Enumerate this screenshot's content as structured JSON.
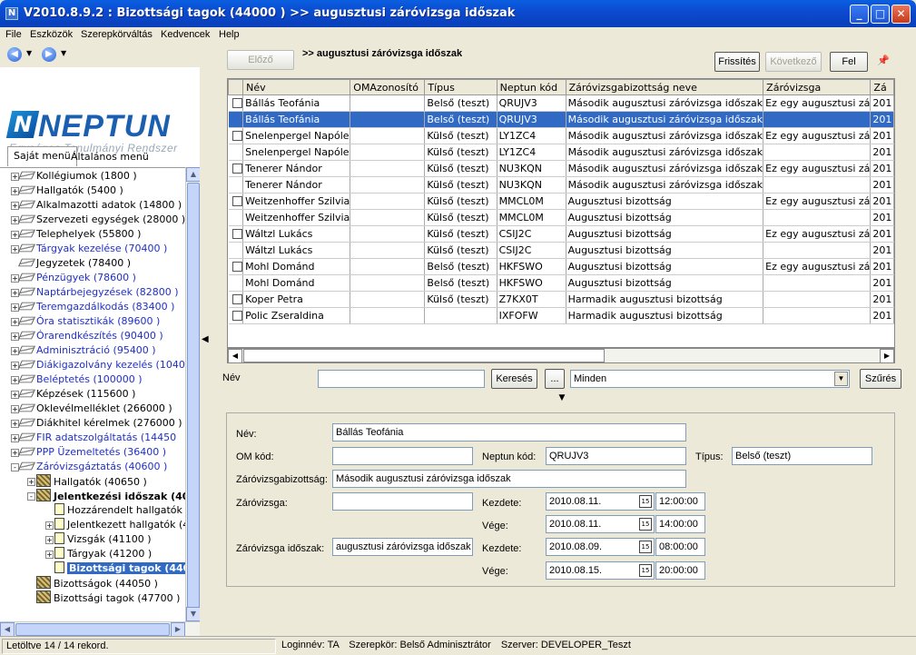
{
  "window": {
    "title": "V2010.8.9.2 : Bizottsági tagok (44000  )  >> augusztusi záróvizsga időszak",
    "icon_letter": "N",
    "min_glyph": "_",
    "max_glyph": "□",
    "close_glyph": "✕"
  },
  "menu": [
    "File",
    "Eszközök",
    "Szerepkörváltás",
    "Kedvencek",
    "Help"
  ],
  "logo": {
    "text": "NEPTUN",
    "mark": "N",
    "subtitle": "Egységes Tanulmányi Rendszer"
  },
  "left_tabs": {
    "own": "Saját menü",
    "general": "Általános menü"
  },
  "tree": [
    {
      "label": "Kollégiumok (1800  )",
      "color": "black",
      "level": 0,
      "icon": "pen",
      "exp": "+"
    },
    {
      "label": "Hallgatók (5400  )",
      "color": "black",
      "level": 0,
      "icon": "pen",
      "exp": "+"
    },
    {
      "label": "Alkalmazotti adatok (14800  )",
      "color": "black",
      "level": 0,
      "icon": "pen",
      "exp": "+"
    },
    {
      "label": "Szervezeti egységek (28000  )",
      "color": "black",
      "level": 0,
      "icon": "pen",
      "exp": "+"
    },
    {
      "label": "Telephelyek (55800  )",
      "color": "black",
      "level": 0,
      "icon": "pen",
      "exp": "+"
    },
    {
      "label": "Tárgyak kezelése (70400  )",
      "color": "blue",
      "level": 0,
      "icon": "pen",
      "exp": "+"
    },
    {
      "label": "Jegyzetek (78400  )",
      "color": "black",
      "level": 0,
      "icon": "pen",
      "exp": ""
    },
    {
      "label": "Pénzügyek (78600  )",
      "color": "blue",
      "level": 0,
      "icon": "pen",
      "exp": "+"
    },
    {
      "label": "Naptárbejegyzések (82800  )",
      "color": "blue",
      "level": 0,
      "icon": "pen",
      "exp": "+"
    },
    {
      "label": "Teremgazdálkodás (83400  )",
      "color": "blue",
      "level": 0,
      "icon": "pen",
      "exp": "+"
    },
    {
      "label": "Óra statisztikák (89600  )",
      "color": "blue",
      "level": 0,
      "icon": "pen",
      "exp": "+"
    },
    {
      "label": "Órarendkészítés (90400  )",
      "color": "blue",
      "level": 0,
      "icon": "pen",
      "exp": "+"
    },
    {
      "label": "Adminisztráció (95400  )",
      "color": "blue",
      "level": 0,
      "icon": "pen",
      "exp": "+"
    },
    {
      "label": "Diákigazolvány kezelés (10400",
      "color": "blue",
      "level": 0,
      "icon": "pen",
      "exp": "+"
    },
    {
      "label": "Beléptetés (100000  )",
      "color": "blue",
      "level": 0,
      "icon": "pen",
      "exp": "+"
    },
    {
      "label": "Képzések (115600  )",
      "color": "black",
      "level": 0,
      "icon": "pen",
      "exp": "+"
    },
    {
      "label": "Oklevélmelléklet (266000  )",
      "color": "black",
      "level": 0,
      "icon": "pen",
      "exp": "+"
    },
    {
      "label": "Diákhitel kérelmek (276000  )",
      "color": "black",
      "level": 0,
      "icon": "pen",
      "exp": "+"
    },
    {
      "label": "FIR adatszolgáltatás (14450",
      "color": "blue",
      "level": 0,
      "icon": "pen",
      "exp": "+"
    },
    {
      "label": "PPP Üzemeltetés (36400  )",
      "color": "blue",
      "level": 0,
      "icon": "pen",
      "exp": "+"
    },
    {
      "label": "Záróvizsgáztatás (40600  )",
      "color": "blue",
      "level": 0,
      "icon": "pen",
      "exp": "-"
    },
    {
      "label": "Hallgatók (40650  )",
      "color": "black",
      "level": 1,
      "icon": "grp",
      "exp": "+"
    },
    {
      "label": "Jelentkezési időszak (40",
      "color": "black",
      "level": 1,
      "icon": "grp",
      "exp": "-",
      "bold": true
    },
    {
      "label": "Hozzárendelt hallgatók (4",
      "color": "black",
      "level": 2,
      "icon": "doc",
      "exp": ""
    },
    {
      "label": "Jelentkezett hallgatók (41",
      "color": "black",
      "level": 2,
      "icon": "doc",
      "exp": "+"
    },
    {
      "label": "Vizsgák (41100  )",
      "color": "black",
      "level": 2,
      "icon": "doc",
      "exp": "+"
    },
    {
      "label": "Tárgyak (41200  )",
      "color": "black",
      "level": 2,
      "icon": "doc",
      "exp": "+"
    },
    {
      "label": "Bizottsági tagok (440",
      "color": "black",
      "level": 2,
      "icon": "doc",
      "exp": "",
      "selected": true
    },
    {
      "label": "Bizottságok (44050  )",
      "color": "black",
      "level": 1,
      "icon": "grp",
      "exp": ""
    },
    {
      "label": "Bizottsági tagok (47700  )",
      "color": "black",
      "level": 1,
      "icon": "grp",
      "exp": ""
    }
  ],
  "toolbar": {
    "prev": "Előző",
    "title": ">> augusztusi záróvizsga időszak",
    "refresh": "Frissítés",
    "next": "Következő",
    "up": "Fel",
    "pin_glyph": "📌"
  },
  "grid": {
    "columns": [
      "",
      "Név",
      "OMAzonosító",
      "Típus",
      "Neptun kód",
      "Záróvizsgabizottság neve",
      "Záróvizsga",
      "Zá"
    ],
    "rows": [
      {
        "check": true,
        "cells": [
          "Bállás Teofánia",
          "",
          "Belső (teszt)",
          "QRUJV3",
          "Második augusztusi záróvizsga időszak",
          "Ez egy augusztusi zá",
          "201"
        ]
      },
      {
        "check": false,
        "selected": true,
        "cells": [
          "Bállás Teofánia",
          "",
          "Belső (teszt)",
          "QRUJV3",
          "Második augusztusi záróvizsga időszak",
          "",
          "201"
        ]
      },
      {
        "check": true,
        "cells": [
          "Snelenpergel Napóle",
          "",
          "Külső (teszt)",
          "LY1ZC4",
          "Második augusztusi záróvizsga időszak",
          "Ez egy augusztusi zá",
          "201"
        ]
      },
      {
        "check": false,
        "cells": [
          "Snelenpergel Napóle",
          "",
          "Külső (teszt)",
          "LY1ZC4",
          "Második augusztusi záróvizsga időszak",
          "",
          "201"
        ]
      },
      {
        "check": true,
        "cells": [
          "Tenerer Nándor",
          "",
          "Külső (teszt)",
          "NU3KQN",
          "Második augusztusi záróvizsga időszak",
          "Ez egy augusztusi zá",
          "201"
        ]
      },
      {
        "check": false,
        "cells": [
          "Tenerer Nándor",
          "",
          "Külső (teszt)",
          "NU3KQN",
          "Második augusztusi záróvizsga időszak",
          "",
          "201"
        ]
      },
      {
        "check": true,
        "cells": [
          "Weitzenhoffer Szilvia",
          "",
          "Külső (teszt)",
          "MMCL0M",
          "Augusztusi bizottság",
          "Ez egy augusztusi zá",
          "201"
        ]
      },
      {
        "check": false,
        "cells": [
          "Weitzenhoffer Szilvia",
          "",
          "Külső (teszt)",
          "MMCL0M",
          "Augusztusi bizottság",
          "",
          "201"
        ]
      },
      {
        "check": true,
        "cells": [
          "Wáltzl Lukács",
          "",
          "Külső (teszt)",
          "CSIJ2C",
          "Augusztusi bizottság",
          "Ez egy augusztusi zá",
          "201"
        ]
      },
      {
        "check": false,
        "cells": [
          "Wáltzl Lukács",
          "",
          "Külső (teszt)",
          "CSIJ2C",
          "Augusztusi bizottság",
          "",
          "201"
        ]
      },
      {
        "check": true,
        "cells": [
          "Mohl Dománd",
          "",
          "Belső (teszt)",
          "HKFSWO",
          "Augusztusi bizottság",
          "Ez egy augusztusi zá",
          "201"
        ]
      },
      {
        "check": false,
        "cells": [
          "Mohl Dománd",
          "",
          "Belső (teszt)",
          "HKFSWO",
          "Augusztusi bizottság",
          "",
          "201"
        ]
      },
      {
        "check": true,
        "cells": [
          "Koper Petra",
          "",
          "Külső (teszt)",
          "Z7KX0T",
          "Harmadik augusztusi bizottság",
          "",
          "201"
        ]
      },
      {
        "check": true,
        "cells": [
          "Polic Zseraldina",
          "",
          "",
          "IXFOFW",
          "Harmadik augusztusi bizottság",
          "",
          "201"
        ]
      }
    ]
  },
  "search": {
    "label": "Név",
    "value": "",
    "search_btn": "Keresés",
    "more_btn": "...",
    "filter": "Minden",
    "filter_btn": "Szűrés"
  },
  "detail": {
    "name_label": "Név:",
    "name": "Bállás Teofánia",
    "om_label": "OM kód:",
    "om": "",
    "neptun_label": "Neptun kód:",
    "neptun": "QRUJV3",
    "type_label": "Típus:",
    "type": "Belső (teszt)",
    "committee_label": "Záróvizsgabizottság:",
    "committee": "Második augusztusi záróvizsga időszak",
    "exam_label": "Záróvizsga:",
    "exam": "",
    "period_label": "Záróvizsga időszak:",
    "period": "augusztusi záróvizsga időszak",
    "start_label": "Kezdete:",
    "end_label": "Vége:",
    "exam_start_date": "2010.08.11.",
    "exam_start_time": "12:00:00",
    "exam_end_date": "2010.08.11.",
    "exam_end_time": "14:00:00",
    "period_start_date": "2010.08.09.",
    "period_start_time": "08:00:00",
    "period_end_date": "2010.08.15.",
    "period_end_time": "20:00:00",
    "cal_glyph": "15"
  },
  "status": {
    "records": "Letöltve 14 / 14 rekord.",
    "login": "Loginnév: TA",
    "role": "Szerepkör: Belső Adminisztrátor",
    "server": "Szerver: DEVELOPER_Teszt"
  }
}
